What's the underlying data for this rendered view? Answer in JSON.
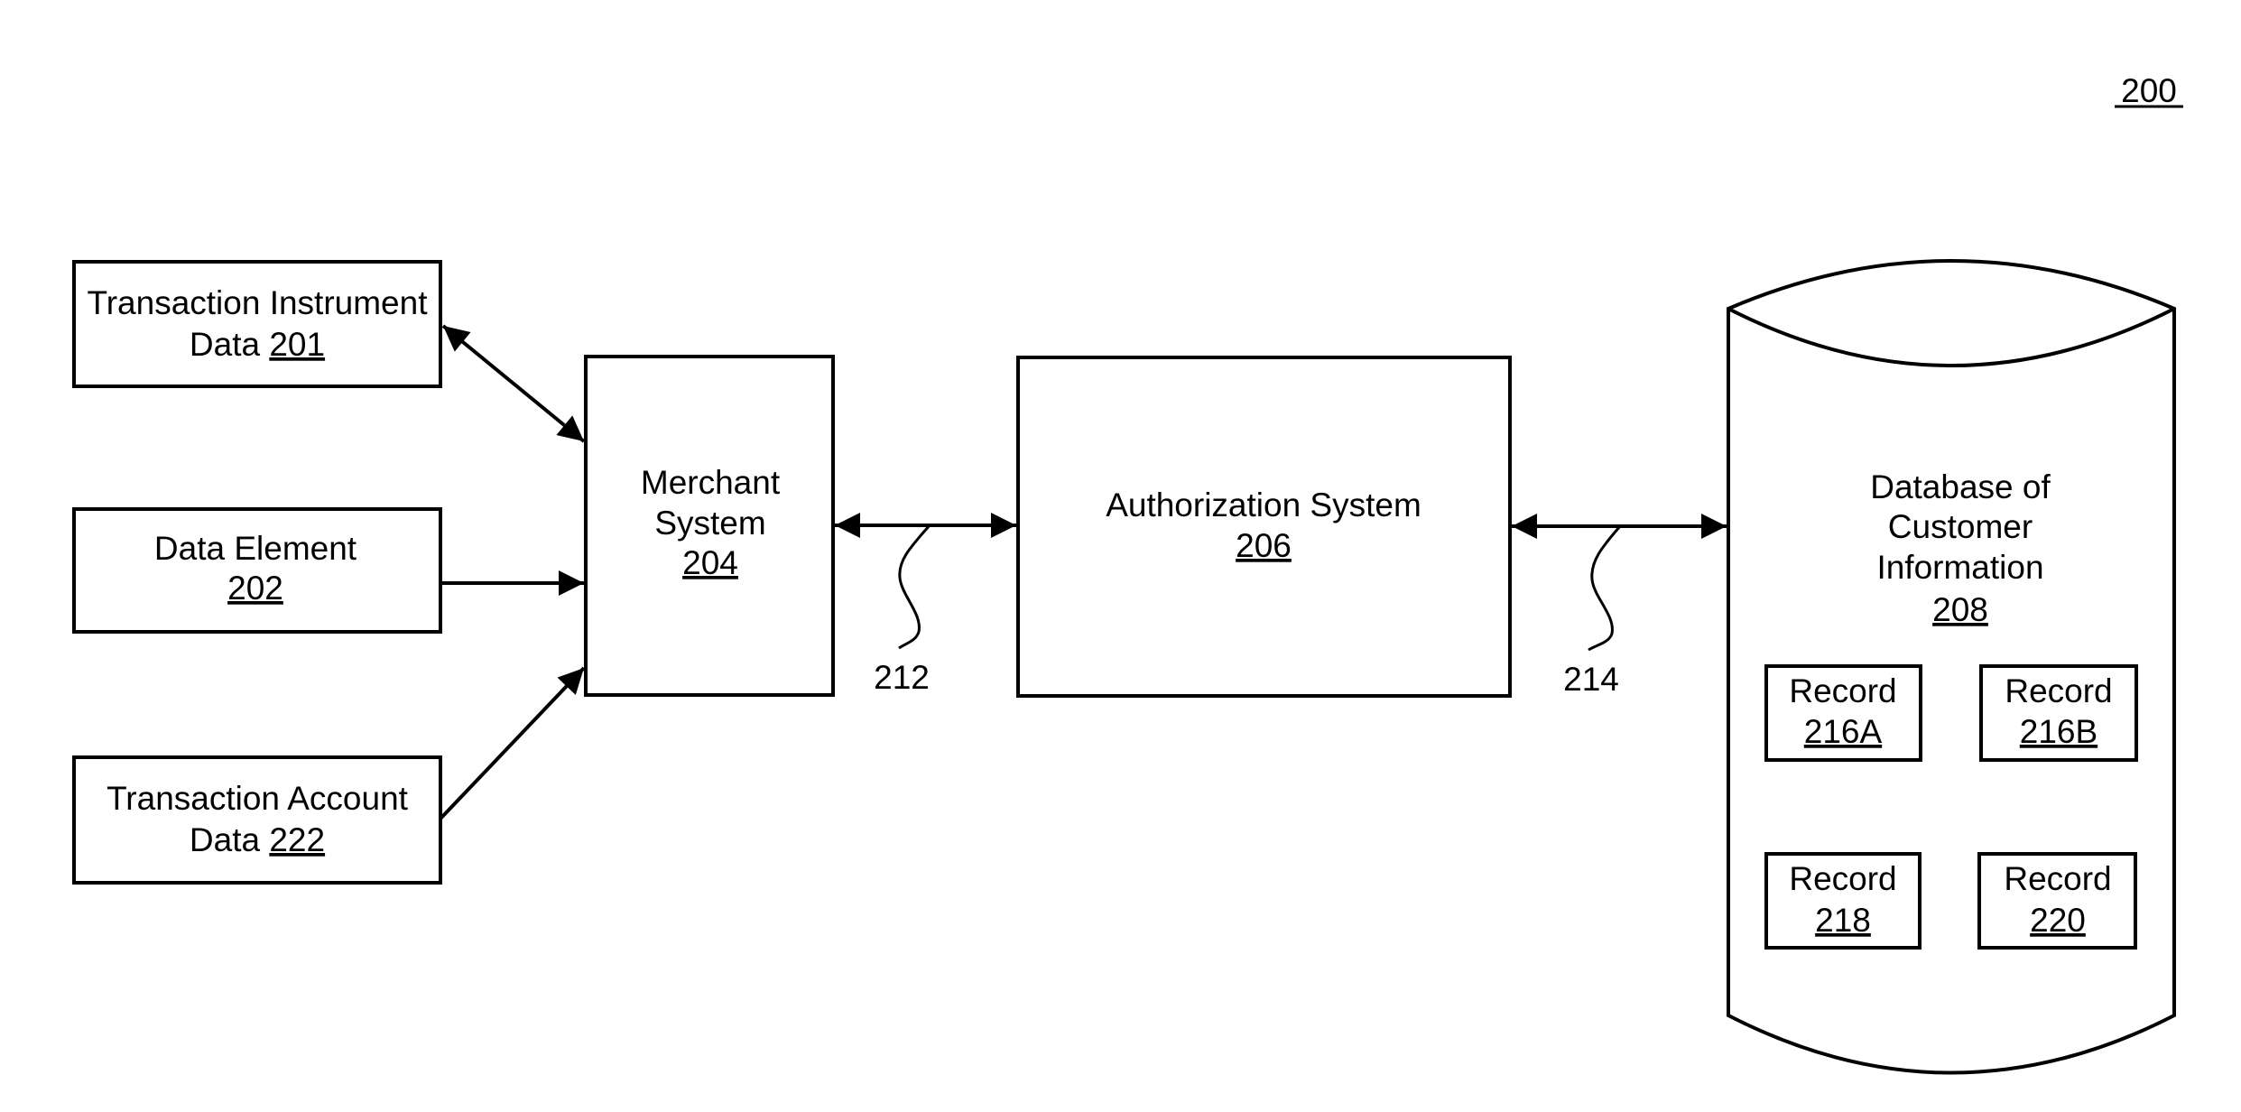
{
  "figure": {
    "number": "200"
  },
  "nodes": {
    "transaction_instrument": {
      "lines": [
        "Transaction Instrument",
        "Data "
      ],
      "ref": "201"
    },
    "data_element": {
      "lines": [
        "Data Element"
      ],
      "ref": "202"
    },
    "transaction_account": {
      "lines": [
        "Transaction Account",
        "Data "
      ],
      "ref": "222"
    },
    "merchant": {
      "lines": [
        "Merchant",
        "System"
      ],
      "ref": "204"
    },
    "authorization": {
      "lines": [
        "Authorization System"
      ],
      "ref": "206"
    },
    "database": {
      "lines": [
        "Database of",
        "Customer",
        "Information"
      ],
      "ref": "208"
    }
  },
  "records": [
    {
      "label": "Record",
      "ref": "216A"
    },
    {
      "label": "Record",
      "ref": "216B"
    },
    {
      "label": "Record",
      "ref": "218"
    },
    {
      "label": "Record",
      "ref": "220"
    }
  ],
  "connections": {
    "merchant_authorization": {
      "ref": "212",
      "direction": "bidirectional"
    },
    "authorization_database": {
      "ref": "214",
      "direction": "bidirectional"
    },
    "instrument_merchant": {
      "direction": "bidirectional"
    },
    "element_merchant": {
      "direction": "to-merchant"
    },
    "account_merchant": {
      "direction": "to-merchant"
    }
  }
}
